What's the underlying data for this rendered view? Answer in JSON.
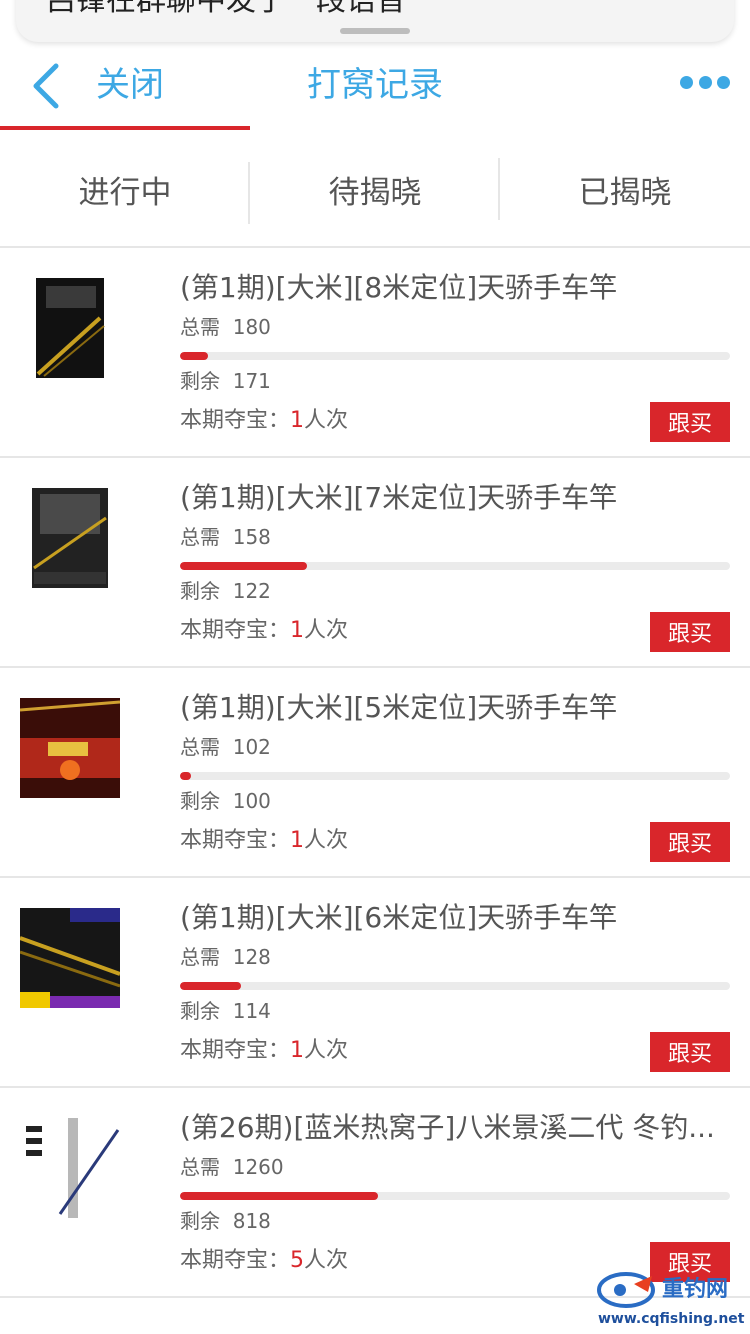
{
  "banner": {
    "text": "吕锋在群聊中发了一段语音"
  },
  "header": {
    "back_label": "关闭",
    "title": "打窝记录"
  },
  "tabs": [
    {
      "label": "进行中",
      "active": true
    },
    {
      "label": "待揭晓",
      "active": false
    },
    {
      "label": "已揭晓",
      "active": false
    }
  ],
  "labels": {
    "total_prefix": "总需",
    "remain_prefix": "剩余",
    "entries_prefix": "本期夺宝：",
    "entries_suffix": "人次",
    "buy_label": "跟买"
  },
  "items": [
    {
      "title": "(第1期)[大米][8米定位]天骄手车竿",
      "total": "180",
      "remain": "171",
      "progress": 0.05,
      "entries": "1"
    },
    {
      "title": "(第1期)[大米][7米定位]天骄手车竿",
      "total": "158",
      "remain": "122",
      "progress": 0.23,
      "entries": "1"
    },
    {
      "title": "(第1期)[大米][5米定位]天骄手车竿",
      "total": "102",
      "remain": "100",
      "progress": 0.02,
      "entries": "1"
    },
    {
      "title": "(第1期)[大米][6米定位]天骄手车竿",
      "total": "128",
      "remain": "114",
      "progress": 0.11,
      "entries": "1"
    },
    {
      "title": "(第26期)[蓝米热窝子]八米景溪二代 冬钓...",
      "total": "1260",
      "remain": "818",
      "progress": 0.36,
      "entries": "5"
    }
  ],
  "watermark": {
    "name": "重钓网",
    "url": "www.cqfishing.net"
  },
  "colors": {
    "accent_blue": "#3da8e4",
    "accent_red": "#d9262b"
  }
}
